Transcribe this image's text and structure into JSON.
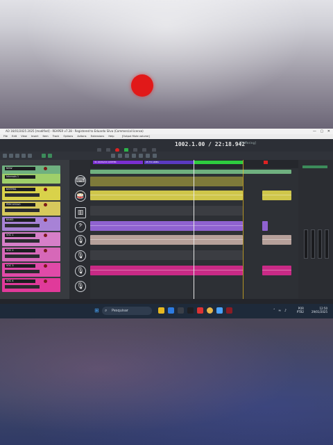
{
  "window": {
    "title": "AO 16/01/2025 2025 [modified] - REAPER v7.28 - Registered to Eduardo Silva (Commercial license)",
    "controls": [
      "—",
      "▢",
      "✕"
    ]
  },
  "menubar": {
    "items": [
      "File",
      "Edit",
      "View",
      "Insert",
      "Item",
      "Track",
      "Options",
      "Actions",
      "Extensions",
      "Help"
    ],
    "right_info": "[Output Mute volume]"
  },
  "transport": {
    "timecode": "1002.1.00 / 22:18.942",
    "status": "[Buffering]"
  },
  "ruler": {
    "markers": [
      "31 20/01/24 C/MITER",
      "25 TO LINEA"
    ]
  },
  "tracks": [
    {
      "name": "NOW",
      "color": "#6fb07f"
    },
    {
      "name": "Internals 1",
      "color": "#9fcf6a"
    },
    {
      "name": "BATERIA",
      "color": "#d9d24a"
    },
    {
      "name": "PERCUSSAO",
      "color": "#d7c95c"
    },
    {
      "name": "BAIXO",
      "color": "#a782d6"
    },
    {
      "name": "VOC 1",
      "color": "#d67fc8"
    },
    {
      "name": "VOC 2",
      "color": "#d668b8"
    },
    {
      "name": "VOC 3",
      "color": "#e04aa8"
    },
    {
      "name": "VOC 4",
      "color": "#e03a9a"
    }
  ],
  "instrument_icons": [
    "keyboard-icon",
    "drum-kit-icon",
    "piano-icon",
    "bass-clef-icon",
    "microphone-icon",
    "microphone-icon",
    "microphone-icon",
    "microphone-icon"
  ],
  "taskbar": {
    "search_placeholder": "Pesquisar",
    "tray_lang": "POR",
    "tray_layout": "PTB2",
    "tray_time": "12:50",
    "tray_date": "29/01/2025"
  }
}
